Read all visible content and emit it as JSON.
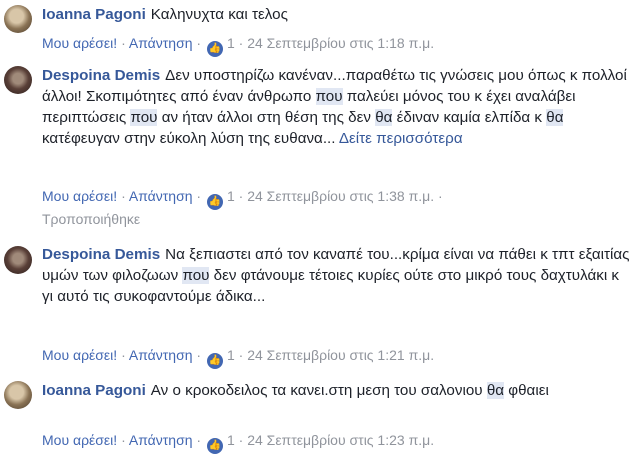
{
  "comments": [
    {
      "author": "Ioanna Pagoni",
      "segments": [
        {
          "t": "Καληνυχτα και τελος"
        }
      ],
      "more": "",
      "like_label": "Μου αρέσει!",
      "reply_label": "Απάντηση",
      "like_count": "1",
      "date": "24 Σεπτεμβρίου στις 1:18 π.μ.",
      "edited": ""
    },
    {
      "author": "Despoina Demis",
      "segments": [
        {
          "t": "Δεν υποστηρίζω κανέναν...παραθέτω τις γνώσεις μου όπως κ πολλοί άλλοι! Σκοπιμότητες από έναν άνθρωπο "
        },
        {
          "t": "που",
          "hl": true
        },
        {
          "t": " παλεύει μόνος του κ έχει αναλάβει περιπτώσεις "
        },
        {
          "t": "που",
          "hl": true
        },
        {
          "t": " αν ήταν άλλοι στη θέση της δεν "
        },
        {
          "t": "θα",
          "hl": true
        },
        {
          "t": " έδιναν καμία ελπίδα κ "
        },
        {
          "t": "θα",
          "hl": true
        },
        {
          "t": " κατέφευγαν στην εύκολη λύση της ευθανα... "
        }
      ],
      "more": "Δείτε περισσότερα",
      "like_label": "Μου αρέσει!",
      "reply_label": "Απάντηση",
      "like_count": "1",
      "date": "24 Σεπτεμβρίου στις 1:38 π.μ.",
      "edited": "Τροποποιήθηκε"
    },
    {
      "author": "Despoina Demis",
      "segments": [
        {
          "t": "Να ξεπιαστει από τον καναπέ του...κρίμα είναι να πάθει κ τπτ εξαιτίας υμών των φιλοζωων "
        },
        {
          "t": "που",
          "hl": true
        },
        {
          "t": " δεν φτάνουμε τέτοιες κυρίες ούτε στο μικρό τους δαχτυλάκι κ γι αυτό τις συκοφαντούμε άδικα..."
        }
      ],
      "more": "",
      "like_label": "Μου αρέσει!",
      "reply_label": "Απάντηση",
      "like_count": "1",
      "date": "24 Σεπτεμβρίου στις 1:21 π.μ.",
      "edited": ""
    },
    {
      "author": "Ioanna Pagoni",
      "segments": [
        {
          "t": "Αν ο κροκοδειλος τα κανει.στη μεση του σαλονιου "
        },
        {
          "t": "θα",
          "hl": true
        },
        {
          "t": " φθαιει"
        }
      ],
      "more": "",
      "like_label": "Μου αρέσει!",
      "reply_label": "Απάντηση",
      "like_count": "1",
      "date": "24 Σεπτεμβρίου στις 1:23 π.μ.",
      "edited": ""
    }
  ],
  "icons": {
    "like": "thumbs-up-icon",
    "avatar": "user-avatar"
  },
  "colors": {
    "link": "#365899",
    "meta": "#90949c",
    "like_bubble": "#4267b2",
    "highlight": "#e1e7f3"
  }
}
